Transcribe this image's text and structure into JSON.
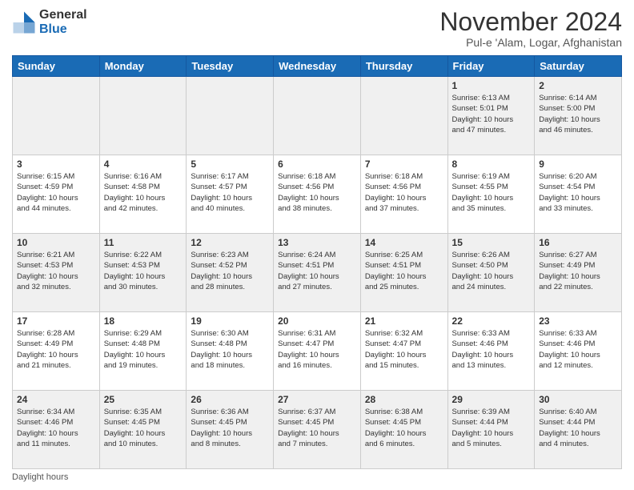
{
  "logo": {
    "general": "General",
    "blue": "Blue"
  },
  "title": "November 2024",
  "subtitle": "Pul-e 'Alam, Logar, Afghanistan",
  "days_of_week": [
    "Sunday",
    "Monday",
    "Tuesday",
    "Wednesday",
    "Thursday",
    "Friday",
    "Saturday"
  ],
  "footer": "Daylight hours",
  "weeks": [
    [
      {
        "day": "",
        "info": ""
      },
      {
        "day": "",
        "info": ""
      },
      {
        "day": "",
        "info": ""
      },
      {
        "day": "",
        "info": ""
      },
      {
        "day": "",
        "info": ""
      },
      {
        "day": "1",
        "info": "Sunrise: 6:13 AM\nSunset: 5:01 PM\nDaylight: 10 hours\nand 47 minutes."
      },
      {
        "day": "2",
        "info": "Sunrise: 6:14 AM\nSunset: 5:00 PM\nDaylight: 10 hours\nand 46 minutes."
      }
    ],
    [
      {
        "day": "3",
        "info": "Sunrise: 6:15 AM\nSunset: 4:59 PM\nDaylight: 10 hours\nand 44 minutes."
      },
      {
        "day": "4",
        "info": "Sunrise: 6:16 AM\nSunset: 4:58 PM\nDaylight: 10 hours\nand 42 minutes."
      },
      {
        "day": "5",
        "info": "Sunrise: 6:17 AM\nSunset: 4:57 PM\nDaylight: 10 hours\nand 40 minutes."
      },
      {
        "day": "6",
        "info": "Sunrise: 6:18 AM\nSunset: 4:56 PM\nDaylight: 10 hours\nand 38 minutes."
      },
      {
        "day": "7",
        "info": "Sunrise: 6:18 AM\nSunset: 4:56 PM\nDaylight: 10 hours\nand 37 minutes."
      },
      {
        "day": "8",
        "info": "Sunrise: 6:19 AM\nSunset: 4:55 PM\nDaylight: 10 hours\nand 35 minutes."
      },
      {
        "day": "9",
        "info": "Sunrise: 6:20 AM\nSunset: 4:54 PM\nDaylight: 10 hours\nand 33 minutes."
      }
    ],
    [
      {
        "day": "10",
        "info": "Sunrise: 6:21 AM\nSunset: 4:53 PM\nDaylight: 10 hours\nand 32 minutes."
      },
      {
        "day": "11",
        "info": "Sunrise: 6:22 AM\nSunset: 4:53 PM\nDaylight: 10 hours\nand 30 minutes."
      },
      {
        "day": "12",
        "info": "Sunrise: 6:23 AM\nSunset: 4:52 PM\nDaylight: 10 hours\nand 28 minutes."
      },
      {
        "day": "13",
        "info": "Sunrise: 6:24 AM\nSunset: 4:51 PM\nDaylight: 10 hours\nand 27 minutes."
      },
      {
        "day": "14",
        "info": "Sunrise: 6:25 AM\nSunset: 4:51 PM\nDaylight: 10 hours\nand 25 minutes."
      },
      {
        "day": "15",
        "info": "Sunrise: 6:26 AM\nSunset: 4:50 PM\nDaylight: 10 hours\nand 24 minutes."
      },
      {
        "day": "16",
        "info": "Sunrise: 6:27 AM\nSunset: 4:49 PM\nDaylight: 10 hours\nand 22 minutes."
      }
    ],
    [
      {
        "day": "17",
        "info": "Sunrise: 6:28 AM\nSunset: 4:49 PM\nDaylight: 10 hours\nand 21 minutes."
      },
      {
        "day": "18",
        "info": "Sunrise: 6:29 AM\nSunset: 4:48 PM\nDaylight: 10 hours\nand 19 minutes."
      },
      {
        "day": "19",
        "info": "Sunrise: 6:30 AM\nSunset: 4:48 PM\nDaylight: 10 hours\nand 18 minutes."
      },
      {
        "day": "20",
        "info": "Sunrise: 6:31 AM\nSunset: 4:47 PM\nDaylight: 10 hours\nand 16 minutes."
      },
      {
        "day": "21",
        "info": "Sunrise: 6:32 AM\nSunset: 4:47 PM\nDaylight: 10 hours\nand 15 minutes."
      },
      {
        "day": "22",
        "info": "Sunrise: 6:33 AM\nSunset: 4:46 PM\nDaylight: 10 hours\nand 13 minutes."
      },
      {
        "day": "23",
        "info": "Sunrise: 6:33 AM\nSunset: 4:46 PM\nDaylight: 10 hours\nand 12 minutes."
      }
    ],
    [
      {
        "day": "24",
        "info": "Sunrise: 6:34 AM\nSunset: 4:46 PM\nDaylight: 10 hours\nand 11 minutes."
      },
      {
        "day": "25",
        "info": "Sunrise: 6:35 AM\nSunset: 4:45 PM\nDaylight: 10 hours\nand 10 minutes."
      },
      {
        "day": "26",
        "info": "Sunrise: 6:36 AM\nSunset: 4:45 PM\nDaylight: 10 hours\nand 8 minutes."
      },
      {
        "day": "27",
        "info": "Sunrise: 6:37 AM\nSunset: 4:45 PM\nDaylight: 10 hours\nand 7 minutes."
      },
      {
        "day": "28",
        "info": "Sunrise: 6:38 AM\nSunset: 4:45 PM\nDaylight: 10 hours\nand 6 minutes."
      },
      {
        "day": "29",
        "info": "Sunrise: 6:39 AM\nSunset: 4:44 PM\nDaylight: 10 hours\nand 5 minutes."
      },
      {
        "day": "30",
        "info": "Sunrise: 6:40 AM\nSunset: 4:44 PM\nDaylight: 10 hours\nand 4 minutes."
      }
    ]
  ]
}
